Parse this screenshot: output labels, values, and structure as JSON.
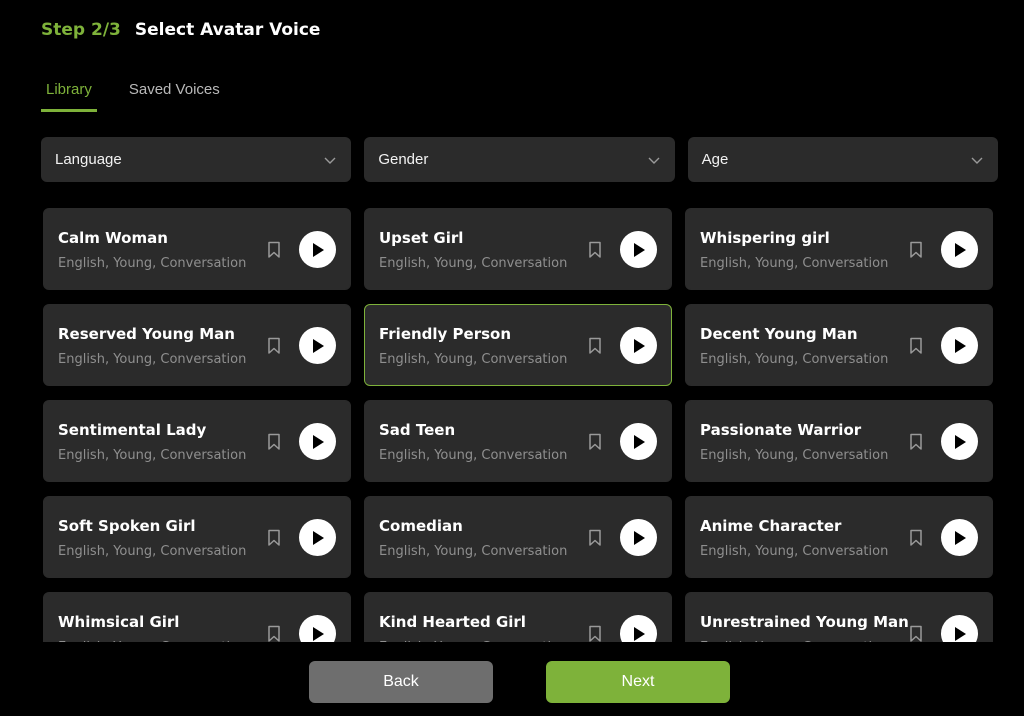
{
  "header": {
    "step": "Step 2/3",
    "title": "Select Avatar Voice"
  },
  "tabs": [
    {
      "label": "Library",
      "active": true
    },
    {
      "label": "Saved Voices",
      "active": false
    }
  ],
  "filters": [
    {
      "label": "Language"
    },
    {
      "label": "Gender"
    },
    {
      "label": "Age"
    }
  ],
  "voices": [
    {
      "name": "Calm Woman",
      "tags": "English, Young, Conversation"
    },
    {
      "name": "Upset Girl",
      "tags": "English, Young, Conversation"
    },
    {
      "name": "Whispering girl",
      "tags": "English, Young, Conversation"
    },
    {
      "name": "Reserved Young Man",
      "tags": "English, Young, Conversation"
    },
    {
      "name": "Friendly Person",
      "tags": "English, Young, Conversation",
      "selected": true
    },
    {
      "name": "Decent Young Man",
      "tags": "English, Young, Conversation"
    },
    {
      "name": "Sentimental Lady",
      "tags": "English, Young, Conversation"
    },
    {
      "name": "Sad Teen",
      "tags": "English, Young, Conversation"
    },
    {
      "name": "Passionate Warrior",
      "tags": "English, Young, Conversation"
    },
    {
      "name": "Soft Spoken Girl",
      "tags": "English, Young, Conversation"
    },
    {
      "name": "Comedian",
      "tags": "English, Young, Conversation"
    },
    {
      "name": "Anime Character",
      "tags": "English, Young, Conversation"
    },
    {
      "name": "Whimsical Girl",
      "tags": "English, Young, Conversation"
    },
    {
      "name": "Kind Hearted Girl",
      "tags": "English, Young, Conversation"
    },
    {
      "name": "Unrestrained Young Man",
      "tags": "English, Young, Conversation"
    }
  ],
  "footer": {
    "back_label": "Back",
    "next_label": "Next"
  },
  "icons": {
    "dropdown": "chevron-down-icon",
    "bookmark": "bookmark-icon",
    "play": "play-icon"
  },
  "colors": {
    "accent": "#7eb23a",
    "card": "#2b2b2b",
    "background": "#000000",
    "back_button": "#6e6e6e"
  }
}
